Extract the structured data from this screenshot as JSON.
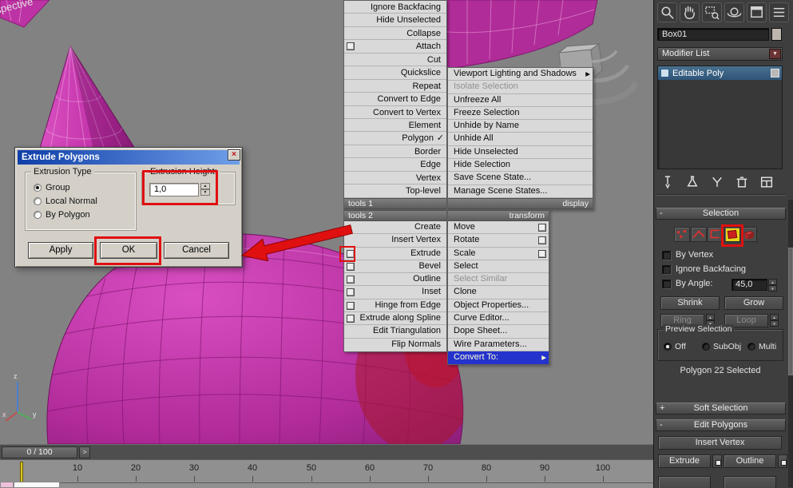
{
  "colors": {
    "object_magenta": "#c837ad",
    "annotation_red": "#e01010",
    "menu_highlight_blue": "#2433cc",
    "active_subobject_yellow": "#e8d318"
  },
  "glyphs": {
    "check": "✓",
    "submenu_arrow": "▶",
    "combo_arrow": "▼",
    "spinner_up": "▲",
    "spinner_down": "▼",
    "close": "×",
    "slider_next": ">",
    "rollout_open": "-",
    "rollout_closed": "+"
  },
  "viewport": {
    "label": "Perspective",
    "axis": {
      "x": "x",
      "y": "y",
      "z": "z"
    }
  },
  "nav_toolbar": {
    "icons": [
      "zoom-icon",
      "pan-icon",
      "zoom-region-icon",
      "orbit-icon",
      "maximize-viewport-icon",
      "menu-icon"
    ]
  },
  "quad_menu": {
    "tools1": {
      "header": "tools 1",
      "items": [
        {
          "label": "Ignore Backfacing"
        },
        {
          "label": "Hide Unselected"
        },
        {
          "label": "Collapse"
        },
        {
          "label": "Attach"
        },
        {
          "label": "Cut"
        },
        {
          "label": "Quickslice"
        },
        {
          "label": "Repeat"
        },
        {
          "label": "Convert to Edge"
        },
        {
          "label": "Convert to Vertex"
        },
        {
          "label": "Element"
        },
        {
          "label": "Polygon"
        },
        {
          "label": "Border"
        },
        {
          "label": "Edge"
        },
        {
          "label": "Vertex"
        },
        {
          "label": "Top-level"
        }
      ]
    },
    "display": {
      "header": "display",
      "items": [
        {
          "label": "Viewport Lighting and Shadows"
        },
        {
          "label": "Isolate Selection"
        },
        {
          "label": "Unfreeze All"
        },
        {
          "label": "Freeze Selection"
        },
        {
          "label": "Unhide by Name"
        },
        {
          "label": "Unhide All"
        },
        {
          "label": "Hide Unselected"
        },
        {
          "label": "Hide Selection"
        },
        {
          "label": "Save Scene State..."
        },
        {
          "label": "Manage Scene States..."
        }
      ]
    },
    "tools2": {
      "header": "tools 2",
      "items": [
        {
          "label": "Create"
        },
        {
          "label": "Insert Vertex"
        },
        {
          "label": "Extrude"
        },
        {
          "label": "Bevel"
        },
        {
          "label": "Outline"
        },
        {
          "label": "Inset"
        },
        {
          "label": "Hinge from Edge"
        },
        {
          "label": "Extrude along Spline"
        },
        {
          "label": "Edit Triangulation"
        },
        {
          "label": "Flip Normals"
        }
      ]
    },
    "transform": {
      "header": "transform",
      "items": [
        {
          "label": "Move"
        },
        {
          "label": "Rotate"
        },
        {
          "label": "Scale"
        },
        {
          "label": "Select"
        },
        {
          "label": "Select Similar"
        },
        {
          "label": "Clone"
        },
        {
          "label": "Object Properties..."
        },
        {
          "label": "Curve Editor..."
        },
        {
          "label": "Dope Sheet..."
        },
        {
          "label": "Wire Parameters..."
        },
        {
          "label": "Convert To:"
        }
      ]
    }
  },
  "dialog": {
    "title": "Extrude Polygons",
    "extrusion_type": {
      "legend": "Extrusion Type",
      "options": [
        {
          "label": "Group",
          "selected": true
        },
        {
          "label": "Local Normal",
          "selected": false
        },
        {
          "label": "By Polygon",
          "selected": false
        }
      ]
    },
    "extrusion_height": {
      "legend": "Extrusion Height:",
      "value": "1,0"
    },
    "buttons": {
      "apply": "Apply",
      "ok": "OK",
      "cancel": "Cancel"
    }
  },
  "command_panel": {
    "object_name": "Box01",
    "modifier_list": "Modifier List",
    "modifier_stack": [
      {
        "label": "Editable Poly",
        "selected": true
      }
    ],
    "stack_toolbar_icons": [
      "pin-stack-icon",
      "show-end-result-icon",
      "make-unique-icon",
      "remove-modifier-icon",
      "configure-modifier-sets-icon"
    ],
    "selection": {
      "title": "Selection",
      "subobject_icons": [
        "vertex-icon",
        "edge-icon",
        "border-icon",
        "polygon-icon",
        "element-icon"
      ],
      "active_subobject": "polygon",
      "by_vertex": "By Vertex",
      "ignore_backfacing": "Ignore Backfacing",
      "by_angle": "By Angle:",
      "by_angle_value": "45,0",
      "shrink": "Shrink",
      "grow": "Grow",
      "ring": "Ring",
      "loop": "Loop",
      "preview": {
        "legend": "Preview Selection",
        "options": [
          {
            "label": "Off",
            "selected": true
          },
          {
            "label": "SubObj",
            "selected": false
          },
          {
            "label": "Multi",
            "selected": false
          }
        ]
      },
      "status": "Polygon 22 Selected"
    },
    "rollouts": {
      "soft_selection": {
        "title": "Soft Selection"
      },
      "edit_polygons": {
        "title": "Edit Polygons"
      }
    },
    "edit_polygons": {
      "insert_vertex": "Insert Vertex",
      "extrude": "Extrude",
      "outline": "Outline"
    }
  },
  "timeline": {
    "slider_label": "0 / 100",
    "ticks": [
      "10",
      "20",
      "30",
      "40",
      "50",
      "60",
      "70",
      "80",
      "90",
      "100"
    ]
  }
}
